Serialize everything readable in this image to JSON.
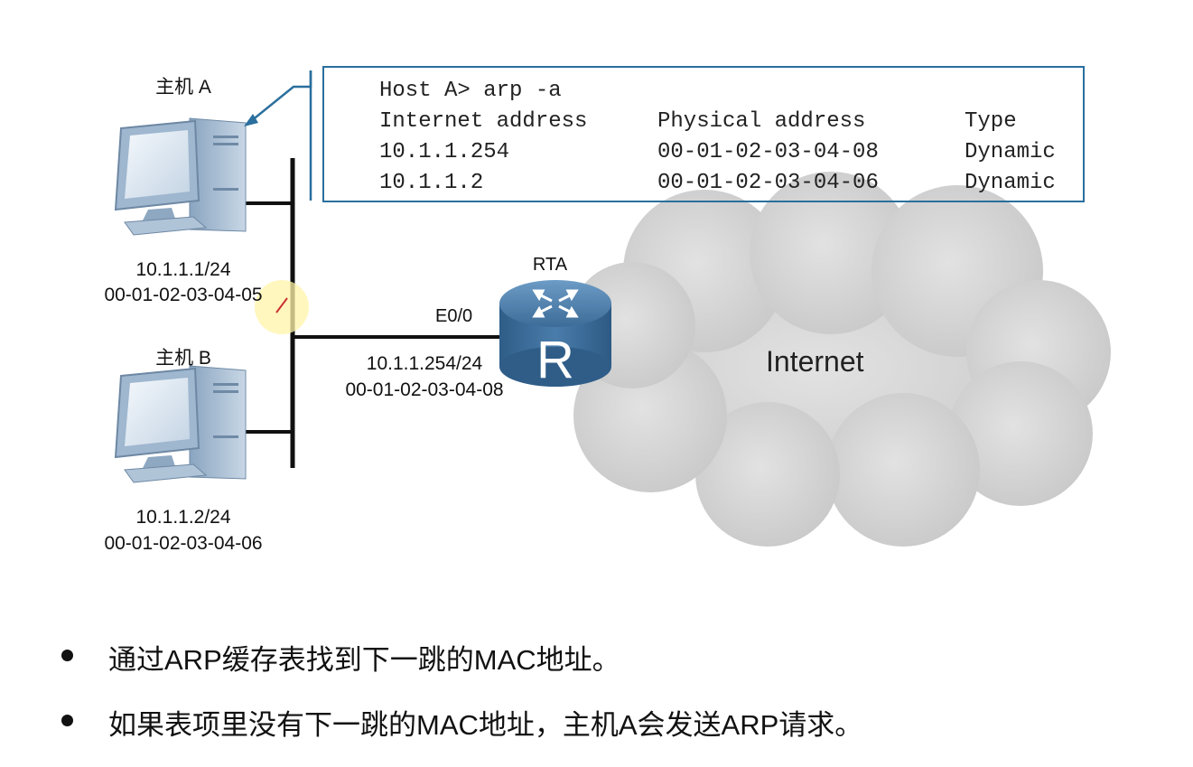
{
  "hosts": [
    {
      "name": "主机 A",
      "ip": "10.1.1.1/24",
      "mac": "00-01-02-03-04-05"
    },
    {
      "name": "主机 B",
      "ip": "10.1.1.2/24",
      "mac": "00-01-02-03-04-06"
    }
  ],
  "router": {
    "name": "RTA",
    "symbol": "R",
    "interface": "E0/0",
    "ip": "10.1.1.254/24",
    "mac": "00-01-02-03-04-08"
  },
  "cloud_label": "Internet",
  "arp_table": {
    "command": "Host A> arp -a",
    "headers": [
      "Internet address",
      "Physical address",
      "Type"
    ],
    "rows": [
      [
        "10.1.1.254",
        "00-01-02-03-04-08",
        "Dynamic"
      ],
      [
        "10.1.1.2",
        "00-01-02-03-04-06",
        "Dynamic"
      ]
    ]
  },
  "bullets": [
    "通过ARP缓存表找到下一跳的MAC地址。",
    "如果表项里没有下一跳的MAC地址，主机A会发送ARP请求。"
  ],
  "colors": {
    "accent": "#2a6f9e",
    "router": "#3f6f9b",
    "cloud": "#d4d4d4",
    "monitor": "#b9cde0"
  }
}
